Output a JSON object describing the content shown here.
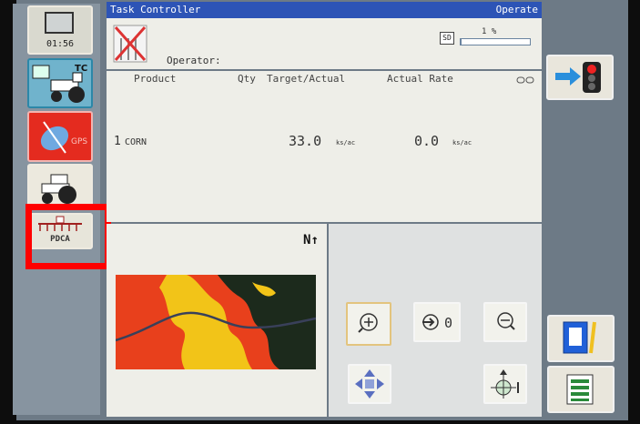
{
  "clock": "01:56",
  "title_bar": {
    "left": "Task Controller",
    "right": "Operate"
  },
  "header": {
    "operator_label": "Operator:",
    "sd_label": "SD",
    "percent_text": "1 %",
    "percent_value": 0.01
  },
  "table": {
    "columns": [
      "Product",
      "Qty",
      "Target/Actual",
      "Actual Rate"
    ],
    "rows": [
      {
        "index": "1",
        "product": "CORN",
        "target": "33.0",
        "target_unit": "ks/ac",
        "actual": "0.0",
        "actual_unit": "ks/ac"
      }
    ]
  },
  "sidebar": {
    "tc_label": "TC",
    "gps_label": "GPS",
    "pdca_label": "PDCA"
  },
  "map": {
    "north_label": "N"
  },
  "zoom": {
    "zero_label": "0"
  },
  "colors": {
    "title_bar": "#2d54b6",
    "highlight": "#ff0000",
    "map_red": "#e8401c",
    "map_yellow": "#f2c418",
    "map_dark": "#1c2a1c"
  }
}
